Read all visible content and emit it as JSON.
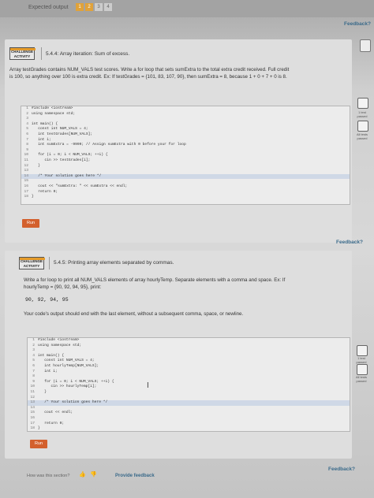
{
  "top": {
    "expected_output": "Expected output",
    "squares": [
      "1",
      "2",
      "3",
      "4"
    ]
  },
  "activity1": {
    "feedback": "Feedback?",
    "badge": [
      "CHALLENGE",
      "ACTIVITY"
    ],
    "title": "5.4.4: Array iteration: Sum of excess.",
    "description": [
      "Array testGrades contains NUM_VALS test scores. Write a for loop that sets sumExtra to the total extra credit received. Full credit",
      "is 100, so anything over 100 is extra credit. Ex: If testGrades = {101, 83, 107, 90}, then sumExtra = 8, because 1 + 0 + 7 + 0 is 8."
    ],
    "code": [
      {
        "n": "1",
        "t": "#include <iostream>"
      },
      {
        "n": "2",
        "t": "using namespace std;"
      },
      {
        "n": "3",
        "t": ""
      },
      {
        "n": "4",
        "t": "int main() {"
      },
      {
        "n": "5",
        "t": "   const int NUM_VALS = 4;"
      },
      {
        "n": "6",
        "t": "   int testGrades[NUM_VALS];"
      },
      {
        "n": "7",
        "t": "   int i;"
      },
      {
        "n": "8",
        "t": "   int sumExtra = -9999; // Assign sumExtra with 0 before your for loop"
      },
      {
        "n": "9",
        "t": ""
      },
      {
        "n": "10",
        "t": "   for (i = 0; i < NUM_VALS; ++i) {"
      },
      {
        "n": "11",
        "t": "      cin >> testGrades[i];"
      },
      {
        "n": "12",
        "t": "   }"
      },
      {
        "n": "13",
        "t": ""
      },
      {
        "n": "14",
        "t": "   /* Your solution goes here */"
      },
      {
        "n": "15",
        "t": ""
      },
      {
        "n": "16",
        "t": "   cout << \"sumExtra: \" << sumExtra << endl;"
      },
      {
        "n": "17",
        "t": "   return 0;"
      },
      {
        "n": "18",
        "t": "}"
      }
    ],
    "run": "Run",
    "side_labels": [
      "1 test passed",
      "All tests passed"
    ]
  },
  "activity2": {
    "feedback": "Feedback?",
    "badge": [
      "CHALLENGE",
      "ACTIVITY"
    ],
    "title": "5.4.5: Printing array elements separated by commas.",
    "description": [
      "Write a for loop to print all NUM_VALS elements of array hourlyTemp. Separate elements with a comma and space. Ex: If",
      "hourlyTemp = {90, 92, 94, 95}, print:"
    ],
    "sample_output": "90, 92, 94, 95",
    "note": "Your code's output should end with the last element, without a subsequent comma, space, or newline.",
    "code": [
      {
        "n": "1",
        "t": "#include <iostream>"
      },
      {
        "n": "2",
        "t": "using namespace std;"
      },
      {
        "n": "3",
        "t": ""
      },
      {
        "n": "4",
        "t": "int main() {"
      },
      {
        "n": "5",
        "t": "   const int NUM_VALS = 4;"
      },
      {
        "n": "6",
        "t": "   int hourlyTemp[NUM_VALS];"
      },
      {
        "n": "7",
        "t": "   int i;"
      },
      {
        "n": "8",
        "t": ""
      },
      {
        "n": "9",
        "t": "   for (i = 0; i < NUM_VALS; ++i) {"
      },
      {
        "n": "10",
        "t": "      cin >> hourlyTemp[i];"
      },
      {
        "n": "11",
        "t": "   }"
      },
      {
        "n": "12",
        "t": ""
      },
      {
        "n": "13",
        "t": "   /* Your solution goes here */"
      },
      {
        "n": "14",
        "t": ""
      },
      {
        "n": "15",
        "t": "   cout << endl;"
      },
      {
        "n": "16",
        "t": ""
      },
      {
        "n": "17",
        "t": "   return 0;"
      },
      {
        "n": "18",
        "t": "}"
      }
    ],
    "run": "Run",
    "side_labels": [
      "1 test passed",
      "All tests passed"
    ],
    "bottom_feedback": "Feedback?"
  },
  "footer": {
    "question": "How was this section?",
    "provide": "Provide feedback"
  }
}
